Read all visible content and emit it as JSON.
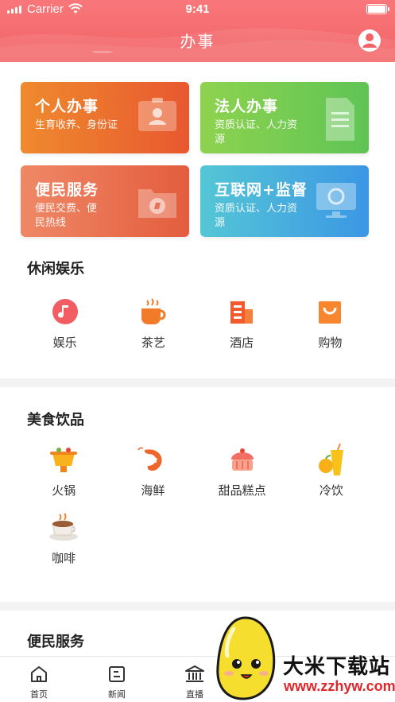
{
  "status_bar": {
    "carrier": "Carrier",
    "time": "9:41"
  },
  "header": {
    "title": "办事"
  },
  "service_tiles": [
    {
      "title": "个人办事",
      "subtitle": "生育收养、身份证",
      "icon": "person-card-icon"
    },
    {
      "title": "法人办事",
      "subtitle": "资质认证、人力资源",
      "icon": "document-icon"
    },
    {
      "title": "便民服务",
      "subtitle": "便民交费、便民热线",
      "icon": "folder-compass-icon"
    },
    {
      "title": "互联网+监督",
      "subtitle": "资质认证、人力资源",
      "icon": "monitor-icon"
    }
  ],
  "leisure": {
    "title": "休闲娱乐",
    "items": [
      {
        "label": "娱乐",
        "icon": "music-icon"
      },
      {
        "label": "茶艺",
        "icon": "teacup-icon"
      },
      {
        "label": "酒店",
        "icon": "hotel-icon"
      },
      {
        "label": "购物",
        "icon": "shopping-bag-icon"
      }
    ]
  },
  "food": {
    "title": "美食饮品",
    "items": [
      {
        "label": "火锅",
        "icon": "hotpot-icon"
      },
      {
        "label": "海鲜",
        "icon": "shrimp-icon"
      },
      {
        "label": "甜品糕点",
        "icon": "cake-icon"
      },
      {
        "label": "冷饮",
        "icon": "cold-drink-icon"
      },
      {
        "label": "咖啡",
        "icon": "coffee-icon"
      }
    ]
  },
  "convenience": {
    "title": "便民服务"
  },
  "tabbar": [
    {
      "label": "首页",
      "icon": "home-icon"
    },
    {
      "label": "新闻",
      "icon": "news-icon"
    },
    {
      "label": "直播",
      "icon": "bank-icon"
    }
  ],
  "watermark": {
    "name": "大米下载站",
    "url": "www.zzhyw.com"
  },
  "colors": {
    "header": "#f26366",
    "orange": "#e8582f",
    "green": "#5fc455",
    "blue": "#3b97e4",
    "watermark_red": "#e0262a"
  }
}
